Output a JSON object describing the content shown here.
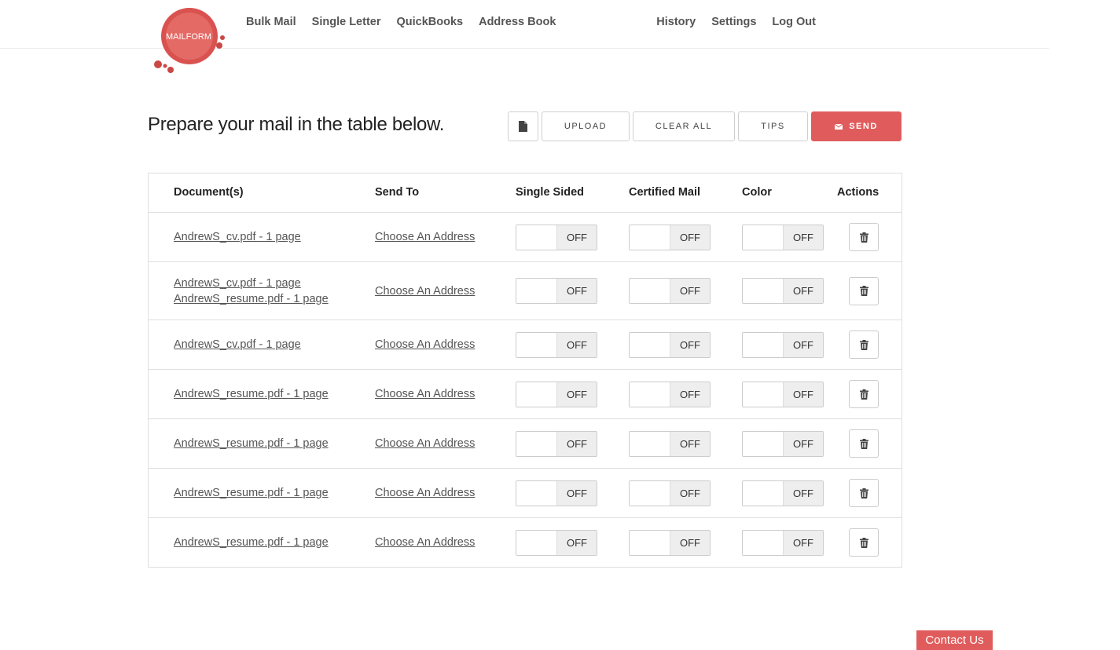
{
  "brand": {
    "logo_text": "MAILFORM",
    "accent": "#e05c5c"
  },
  "nav": {
    "left": [
      "Bulk Mail",
      "Single Letter",
      "QuickBooks",
      "Address Book"
    ],
    "right": [
      "History",
      "Settings",
      "Log Out"
    ]
  },
  "toolbar": {
    "heading": "Prepare your mail in the table below.",
    "doc_icon": "document-icon",
    "upload": "UPLOAD",
    "clear_all": "CLEAR ALL",
    "tips": "TIPS",
    "send": "SEND",
    "send_icon": "envelope-icon"
  },
  "table": {
    "headers": [
      "Document(s)",
      "Send To",
      "Single Sided",
      "Certified Mail",
      "Color",
      "Actions"
    ],
    "rows": [
      {
        "documents": [
          "AndrewS_cv.pdf - 1 page"
        ],
        "send_to": "Choose An Address",
        "single_sided": "OFF",
        "certified": "OFF",
        "color": "OFF"
      },
      {
        "documents": [
          "AndrewS_cv.pdf - 1 page",
          "AndrewS_resume.pdf - 1 page"
        ],
        "send_to": "Choose An Address",
        "single_sided": "OFF",
        "certified": "OFF",
        "color": "OFF"
      },
      {
        "documents": [
          "AndrewS_cv.pdf - 1 page"
        ],
        "send_to": "Choose An Address",
        "single_sided": "OFF",
        "certified": "OFF",
        "color": "OFF"
      },
      {
        "documents": [
          "AndrewS_resume.pdf - 1 page"
        ],
        "send_to": "Choose An Address",
        "single_sided": "OFF",
        "certified": "OFF",
        "color": "OFF"
      },
      {
        "documents": [
          "AndrewS_resume.pdf - 1 page"
        ],
        "send_to": "Choose An Address",
        "single_sided": "OFF",
        "certified": "OFF",
        "color": "OFF"
      },
      {
        "documents": [
          "AndrewS_resume.pdf - 1 page"
        ],
        "send_to": "Choose An Address",
        "single_sided": "OFF",
        "certified": "OFF",
        "color": "OFF"
      },
      {
        "documents": [
          "AndrewS_resume.pdf - 1 page"
        ],
        "send_to": "Choose An Address",
        "single_sided": "OFF",
        "certified": "OFF",
        "color": "OFF"
      }
    ],
    "delete_icon": "trash-icon"
  },
  "footer": {
    "contact": "Contact Us"
  }
}
